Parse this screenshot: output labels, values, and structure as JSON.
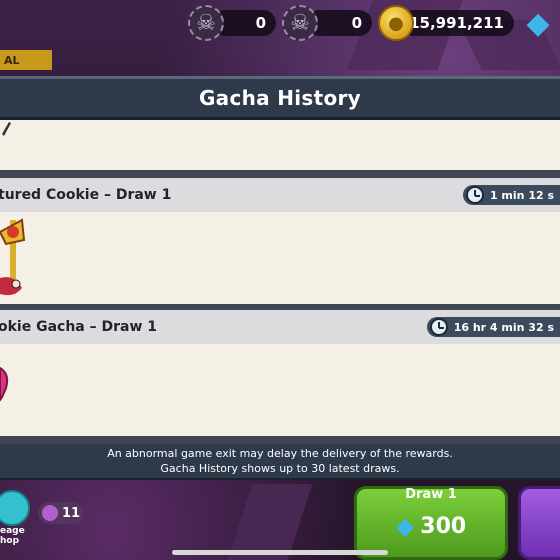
{
  "currencies": [
    {
      "icon": "ghost-token-icon",
      "value": "0"
    },
    {
      "icon": "ghost-token-icon",
      "value": "0"
    },
    {
      "icon": "coin-icon",
      "value": "15,991,211"
    },
    {
      "icon": "crystal-icon",
      "value": ""
    }
  ],
  "event_tag": "AL",
  "modal": {
    "title": "Gacha History",
    "entries": [
      {
        "title": "tured Cookie – Draw 1",
        "time": "1 min 12 s"
      },
      {
        "title": "okie Gacha – Draw 1",
        "time": "16 hr 4 min 32 s"
      }
    ],
    "notice": [
      "An abnormal game exit may delay the delivery of the rewards.",
      "Gacha History shows up to 30 latest draws."
    ]
  },
  "bottom": {
    "draw_label": "Draw 1",
    "draw_price": "300",
    "lineage_label_1": "eage",
    "lineage_label_2": "hop",
    "badge_count": "11"
  },
  "colors": {
    "header_bg": "#2e3a4a",
    "entry_bg": "#f4f0e6",
    "entry_head_bg": "#dcdcde",
    "draw_button": "#5fb02a"
  }
}
